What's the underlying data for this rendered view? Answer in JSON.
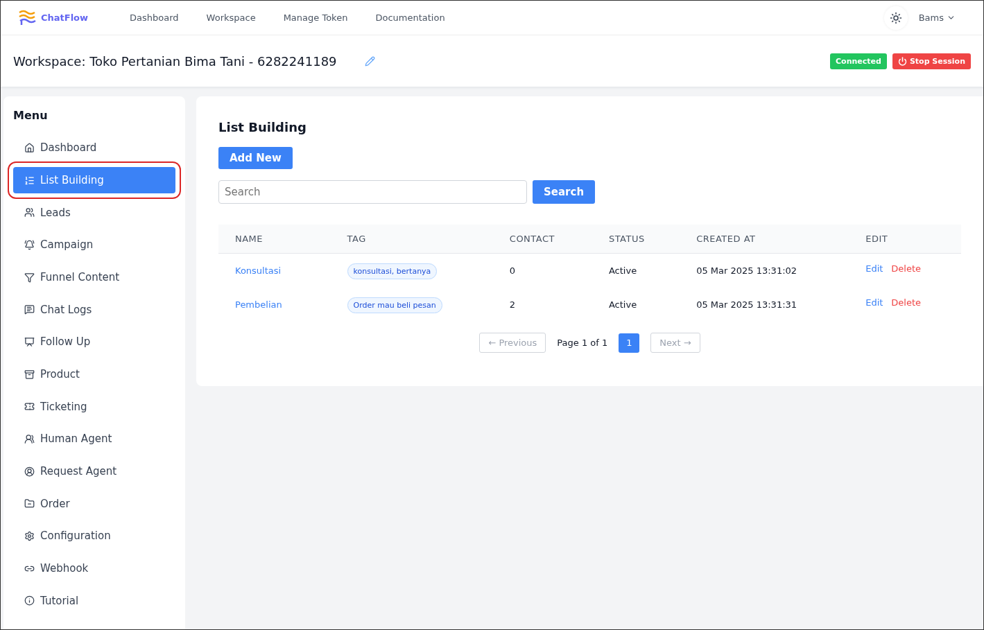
{
  "brand": "ChatFlow",
  "nav": [
    "Dashboard",
    "Workspace",
    "Manage Token",
    "Documentation"
  ],
  "user": "Bams",
  "workspace_title": "Workspace: Toko Pertanian Bima Tani - 6282241189",
  "status_badge": "Connected",
  "stop_button": "Stop Session",
  "menu_title": "Menu",
  "menu": [
    {
      "label": "Dashboard",
      "selected": false,
      "highlighted": false
    },
    {
      "label": "List Building",
      "selected": true,
      "highlighted": true
    },
    {
      "label": "Leads",
      "selected": false,
      "highlighted": false
    },
    {
      "label": "Campaign",
      "selected": false,
      "highlighted": false
    },
    {
      "label": "Funnel Content",
      "selected": false,
      "highlighted": false
    },
    {
      "label": "Chat Logs",
      "selected": false,
      "highlighted": false
    },
    {
      "label": "Follow Up",
      "selected": false,
      "highlighted": false
    },
    {
      "label": "Product",
      "selected": false,
      "highlighted": false
    },
    {
      "label": "Ticketing",
      "selected": false,
      "highlighted": false
    },
    {
      "label": "Human Agent",
      "selected": false,
      "highlighted": false
    },
    {
      "label": "Request Agent",
      "selected": false,
      "highlighted": false
    },
    {
      "label": "Order",
      "selected": false,
      "highlighted": false
    },
    {
      "label": "Configuration",
      "selected": false,
      "highlighted": false
    },
    {
      "label": "Webhook",
      "selected": false,
      "highlighted": false
    },
    {
      "label": "Tutorial",
      "selected": false,
      "highlighted": false
    }
  ],
  "page_title": "List Building",
  "add_button": "Add New",
  "search": {
    "placeholder": "Search",
    "button": "Search"
  },
  "table": {
    "columns": [
      "NAME",
      "TAG",
      "CONTACT",
      "STATUS",
      "CREATED AT",
      "EDIT"
    ],
    "rows": [
      {
        "name": "Konsultasi",
        "tag": "konsultasi, bertanya",
        "contact": "0",
        "status": "Active",
        "created_at": "05 Mar 2025 13:31:02",
        "edit": "Edit",
        "delete": "Delete"
      },
      {
        "name": "Pembelian",
        "tag": "Order mau beli pesan",
        "contact": "2",
        "status": "Active",
        "created_at": "05 Mar 2025 13:31:31",
        "edit": "Edit",
        "delete": "Delete"
      }
    ]
  },
  "pagination": {
    "previous": "← Previous",
    "page_info": "Page 1 of 1",
    "pages": [
      {
        "label": "1",
        "selected": true
      }
    ],
    "next": "Next →"
  }
}
